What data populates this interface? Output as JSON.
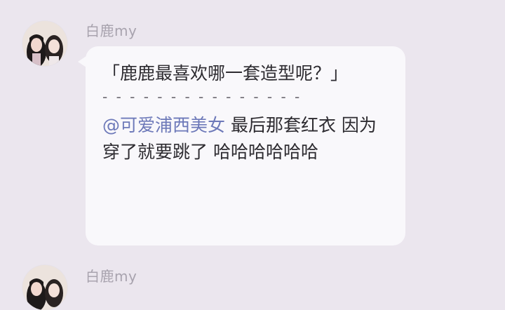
{
  "messages": [
    {
      "sender": "白鹿my",
      "avatar_icon": "avatar-two-girls-photo",
      "quote": "「鹿鹿最喜欢哪一套造型呢？」",
      "divider": "- - - - - - - - - - - - - - -",
      "reply_mention": "@可爱浦西美女",
      "reply_text": " 最后那套红衣 因为穿了就要跳了 哈哈哈哈哈哈"
    },
    {
      "sender": "白鹿my",
      "avatar_icon": "avatar-two-girls-photo"
    }
  ],
  "colors": {
    "background": "#ebe6ee",
    "bubble": "#f9f8fb",
    "mention": "#6d79b9",
    "sender_name": "#a8a3ae"
  }
}
